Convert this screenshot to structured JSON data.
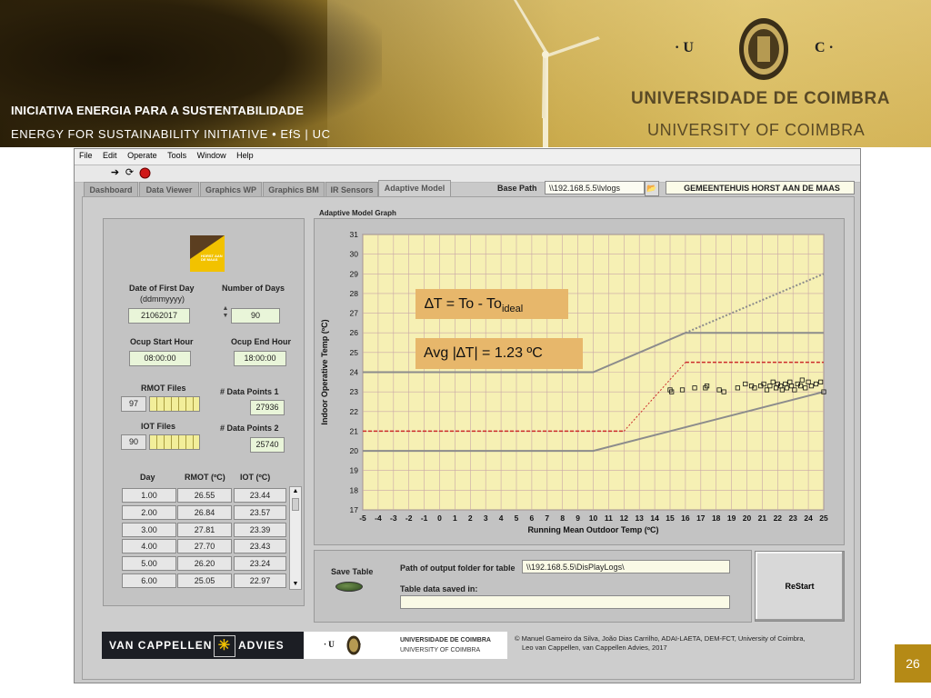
{
  "banner": {
    "initiative_pt": "INICIATIVA ENERGIA  PARA  A  SUSTENTABILIDADE",
    "initiative_en": "ENERGY  FOR  SUSTAINABILITY  INITIATIVE •    EfS | UC",
    "uc_left": "· U",
    "uc_right": "C ·",
    "university_pt": "UNIVERSIDADE  DE  COIMBRA",
    "university_en": "UNIVERSITY  OF  COIMBRA"
  },
  "app": {
    "menu": [
      "File",
      "Edit",
      "Operate",
      "Tools",
      "Window",
      "Help"
    ],
    "tabs": [
      "Dashboard",
      "Data Viewer",
      "Graphics WP",
      "Graphics BM",
      "IR Sensors",
      "Adaptive Model"
    ],
    "active_tab": "Adaptive Model",
    "base_path_label": "Base Path",
    "base_path_value": "\\\\192.168.5.5\\lvlogs",
    "site_name": "GEMEENTEHUIS HORST AAN DE MAAS",
    "graph_title": "Adaptive Model Graph"
  },
  "left": {
    "logo_text": "HORST AAN DE MAAS",
    "date_first_day_label": "Date of First Day",
    "date_format_label": "(ddmmyyyy)",
    "date_first_day_value": "21062017",
    "number_days_label": "Number of Days",
    "number_days_value": "90",
    "ocup_start_label": "Ocup Start Hour",
    "ocup_start_value": "08:00:00",
    "ocup_end_label": "Ocup End Hour",
    "ocup_end_value": "18:00:00",
    "rmot_files_label": "RMOT Files",
    "rmot_files_value": "97",
    "iot_files_label": "IOT Files",
    "iot_files_value": "90",
    "data_points1_label": "# Data Points 1",
    "data_points1_value": "27936",
    "data_points2_label": "# Data Points 2",
    "data_points2_value": "25740",
    "table_headers": [
      "Day",
      "RMOT (ºC)",
      "IOT (ºC)"
    ],
    "table_rows": [
      [
        "1.00",
        "26.55",
        "23.44"
      ],
      [
        "2.00",
        "26.84",
        "23.57"
      ],
      [
        "3.00",
        "27.81",
        "23.39"
      ],
      [
        "4.00",
        "27.70",
        "23.43"
      ],
      [
        "5.00",
        "26.20",
        "23.24"
      ],
      [
        "6.00",
        "25.05",
        "22.97"
      ]
    ]
  },
  "bottom": {
    "save_table_label": "Save Table",
    "output_folder_label": "Path of output folder for table",
    "output_folder_value": "\\\\192.168.5.5\\DisPlayLogs\\",
    "saved_in_label": "Table data saved in:",
    "saved_in_value": "",
    "restart_label": "ReStart"
  },
  "footer": {
    "vc_left": "VAN CAPPELLEN",
    "vc_right": "ADVIES",
    "uc_name_pt": "UNIVERSIDADE DE COIMBRA",
    "uc_name_en": "UNIVERSITY OF COIMBRA",
    "uc_mark": "· U        C ·",
    "copyright_line1": "© Manuel Gameiro da Silva, João Dias Carrilho, ADAI-LAETA, DEM-FCT, University  of Coimbra,",
    "copyright_line2": "Leo van Cappellen, van Cappellen Advies, 2017",
    "page_number": "26"
  },
  "colors": {
    "plot_bg": "#f6f0b4",
    "grid": "#c9a7a7",
    "band_line": "#8c8c8c",
    "ideal_line": "#cc2b2b",
    "annotation_bg": "#e7b76b"
  },
  "chart_data": {
    "type": "scatter",
    "xlabel": "Running Mean Outdoor Temp (ºC)",
    "ylabel": "Indoor Operative Temp (ºC)",
    "xlim": [
      -5,
      25
    ],
    "ylim": [
      17,
      31
    ],
    "x_ticks": [
      -5,
      -4,
      -3,
      -2,
      -1,
      0,
      1,
      2,
      3,
      4,
      5,
      6,
      7,
      8,
      9,
      10,
      11,
      12,
      13,
      14,
      15,
      16,
      17,
      18,
      19,
      20,
      21,
      22,
      23,
      24,
      25
    ],
    "y_ticks": [
      17,
      18,
      19,
      20,
      21,
      22,
      23,
      24,
      25,
      26,
      27,
      28,
      29,
      30,
      31
    ],
    "grid": true,
    "annotation1": "∆T = To - To",
    "annotation1_sub": "ideal",
    "annotation2": "Avg |∆T| = 1.23 ºC",
    "upper_band": [
      [
        -5,
        24
      ],
      [
        10,
        24
      ],
      [
        16,
        26
      ],
      [
        25,
        26
      ]
    ],
    "upper_band_extension": [
      [
        16,
        26
      ],
      [
        25,
        29
      ]
    ],
    "lower_band": [
      [
        -5,
        20
      ],
      [
        10,
        20
      ],
      [
        25,
        23
      ]
    ],
    "ideal_line": [
      [
        -5,
        21
      ],
      [
        12,
        21
      ],
      [
        16,
        24.5
      ],
      [
        25,
        24.5
      ]
    ],
    "points": [
      [
        15,
        23.1
      ],
      [
        15.1,
        23.0
      ],
      [
        15.8,
        23.1
      ],
      [
        16.6,
        23.2
      ],
      [
        17.3,
        23.2
      ],
      [
        17.4,
        23.3
      ],
      [
        18.2,
        23.1
      ],
      [
        18.5,
        23.0
      ],
      [
        19.4,
        23.2
      ],
      [
        19.9,
        23.4
      ],
      [
        20.3,
        23.3
      ],
      [
        20.5,
        23.2
      ],
      [
        20.9,
        23.3
      ],
      [
        21.1,
        23.4
      ],
      [
        21.3,
        23.1
      ],
      [
        21.5,
        23.3
      ],
      [
        21.7,
        23.5
      ],
      [
        21.9,
        23.2
      ],
      [
        22.0,
        23.4
      ],
      [
        22.2,
        23.3
      ],
      [
        22.3,
        23.1
      ],
      [
        22.5,
        23.4
      ],
      [
        22.6,
        23.2
      ],
      [
        22.8,
        23.5
      ],
      [
        22.9,
        23.3
      ],
      [
        23.1,
        23.1
      ],
      [
        23.3,
        23.4
      ],
      [
        23.5,
        23.3
      ],
      [
        23.6,
        23.6
      ],
      [
        23.8,
        23.2
      ],
      [
        24.0,
        23.5
      ],
      [
        24.2,
        23.3
      ],
      [
        24.5,
        23.4
      ],
      [
        24.8,
        23.5
      ],
      [
        25.0,
        23.0
      ]
    ]
  }
}
